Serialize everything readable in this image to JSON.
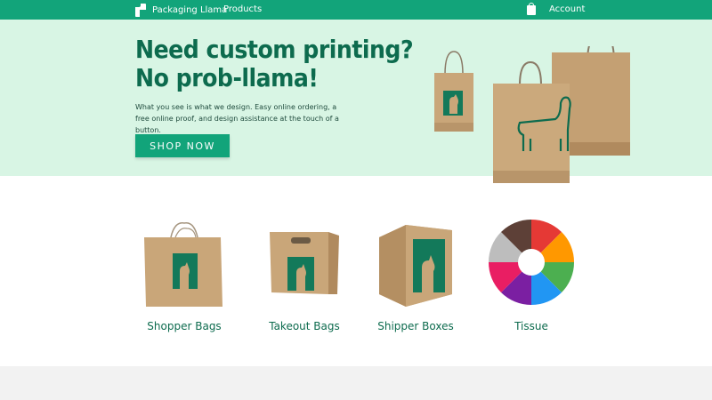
{
  "nav": {
    "brand": "Packaging Llama",
    "products": "Products",
    "account": "Account"
  },
  "hero": {
    "title_line1": "Need custom printing?",
    "title_line2": "No prob-llama!",
    "description": "What you see is what we design. Easy online ordering, a free online proof, and design assistance at the touch of a button.",
    "cta": "SHOP NOW"
  },
  "products": [
    {
      "label": "Shopper Bags",
      "icon": "shopper-bag-icon"
    },
    {
      "label": "Takeout Bags",
      "icon": "takeout-bag-icon"
    },
    {
      "label": "Shipper Boxes",
      "icon": "shipper-box-icon"
    },
    {
      "label": "Tissue",
      "icon": "tissue-wheel-icon"
    }
  ],
  "colors": {
    "brand_green": "#12a47a",
    "hero_bg": "#d8f5e4",
    "dark_green_text": "#0d6b4e",
    "kraft": "#c9a679"
  }
}
